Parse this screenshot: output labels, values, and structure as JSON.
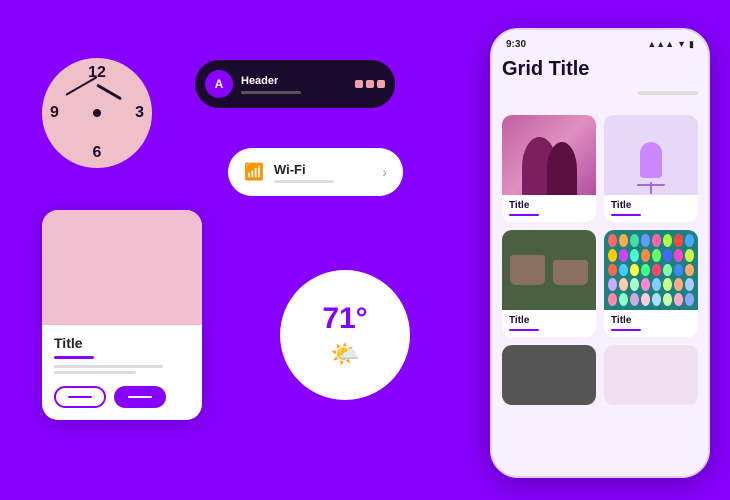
{
  "background_color": "#8800ff",
  "clock": {
    "numbers": {
      "12": "12",
      "3": "3",
      "6": "6",
      "9": "9"
    },
    "aria_label": "Analog Clock"
  },
  "header_bar": {
    "avatar_letter": "A",
    "title": "Header",
    "aria_label": "Header Bar Component"
  },
  "wifi_card": {
    "label": "Wi-Fi",
    "chevron": "›",
    "aria_label": "Wi-Fi Settings Row"
  },
  "card_mockup": {
    "title": "Title",
    "button1_aria": "Outline Button",
    "button2_aria": "Filled Button"
  },
  "weather": {
    "temperature": "71°",
    "sun_emoji": "🌤",
    "aria_label": "Weather Widget"
  },
  "phone": {
    "status_time": "9:30",
    "title": "Grid Title",
    "grid_items": [
      {
        "title": "Title",
        "img_type": "silhouettes"
      },
      {
        "title": "Title",
        "img_type": "microphone"
      },
      {
        "title": "Title",
        "img_type": "plants"
      },
      {
        "title": "Title",
        "img_type": "dots"
      }
    ],
    "dot_colors": [
      "#ff6666",
      "#ffaa44",
      "#44ddaa",
      "#6699ff",
      "#ff66aa",
      "#aaff44",
      "#ff4444",
      "#44aaff",
      "#ffcc00",
      "#cc44ff",
      "#44ffcc",
      "#ff8844",
      "#66ff66",
      "#4466ff",
      "#ff44cc",
      "#ccff44",
      "#ff6644",
      "#44ccff",
      "#ffff44",
      "#44ff88",
      "#ff4466",
      "#88ffaa",
      "#4488ff",
      "#ffaa66",
      "#ccaaff",
      "#ffccaa",
      "#aaffcc",
      "#ff88cc",
      "#88ccff",
      "#ccff88",
      "#ffaa88",
      "#aaccff",
      "#ff88aa",
      "#88ffcc",
      "#ccaadd",
      "#ffccdd",
      "#aaddff",
      "#ccffaa",
      "#ffaacc",
      "#88aaff"
    ]
  }
}
